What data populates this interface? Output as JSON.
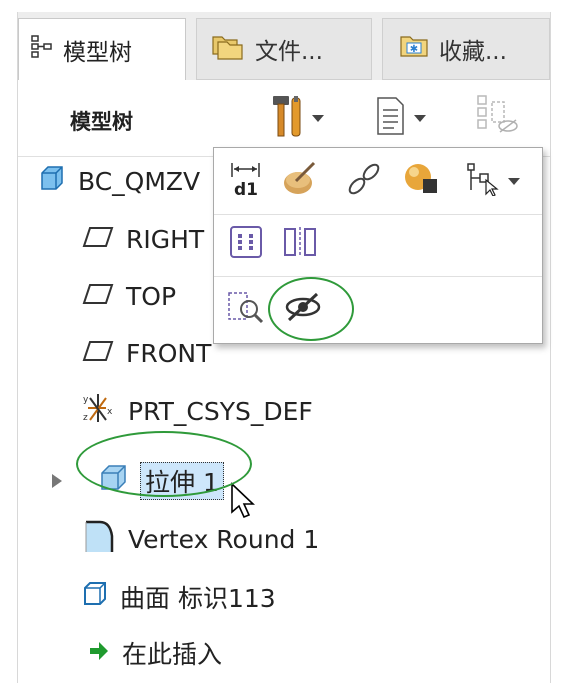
{
  "tabs": [
    {
      "label": "模型树",
      "icon": "model-tree-icon",
      "active": true
    },
    {
      "label": "文件...",
      "icon": "folders-icon",
      "active": false
    },
    {
      "label": "收藏...",
      "icon": "favorites-icon",
      "active": false
    }
  ],
  "toolbar": {
    "title": "模型树",
    "buttons": [
      "settings-tools-icon",
      "show-list-icon",
      "hidden-items-icon"
    ]
  },
  "tree": {
    "items": [
      {
        "label": "BC_QMZV",
        "icon": "part-icon"
      },
      {
        "label": "RIGHT",
        "icon": "datum-plane-icon"
      },
      {
        "label": "TOP",
        "icon": "datum-plane-icon"
      },
      {
        "label": "FRONT",
        "icon": "datum-plane-icon"
      },
      {
        "label": "PRT_CSYS_DEF",
        "icon": "coordinate-system-icon"
      },
      {
        "label": "拉伸 1",
        "icon": "extrude-icon",
        "selected": true,
        "expandable": true
      },
      {
        "label": "Vertex Round 1",
        "icon": "round-icon"
      },
      {
        "label": "曲面 标识113",
        "icon": "surface-icon"
      },
      {
        "label": "在此插入",
        "icon": "insert-here-arrow-icon"
      }
    ]
  },
  "popup": {
    "row1": [
      "dimension-icon",
      "appearance-icon",
      "chain-link-icon",
      "shading-sphere-icon",
      "flow-icon"
    ],
    "row2": [
      "pattern-icon",
      "mirror-icon"
    ],
    "row3": [
      "unhide-icon",
      "hide-icon"
    ]
  },
  "colors": {
    "accent_green": "#2f9a3a",
    "selection": "#cde6fb",
    "tab_bg": "#ededed"
  }
}
